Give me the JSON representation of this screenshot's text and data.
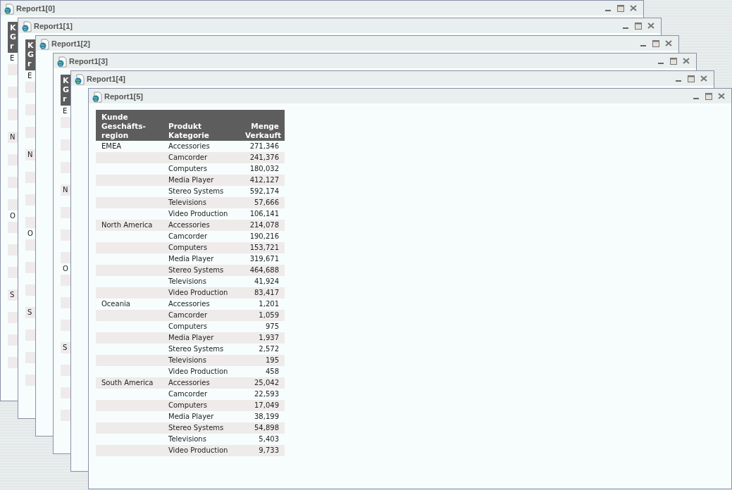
{
  "windows": [
    {
      "title": "Report1[0]",
      "fragment": {
        "header": [
          "K",
          "G",
          "r"
        ],
        "groups": [
          "E",
          "N",
          "O",
          "S"
        ]
      }
    },
    {
      "title": "Report1[1]",
      "fragment": {
        "header": [
          "K",
          "G",
          "r"
        ],
        "groups": [
          "E",
          "N",
          "O",
          "S"
        ]
      }
    },
    {
      "title": "Report1[2]"
    },
    {
      "title": "Report1[3]",
      "fragment": {
        "header": [
          "K",
          "G",
          "r"
        ],
        "groups": [
          "E",
          "N",
          "O",
          "S"
        ]
      }
    },
    {
      "title": "Report1[4]"
    },
    {
      "title": "Report1[5]",
      "report": {
        "columns": [
          "Kunde Geschäfts-region",
          "Produkt Kategorie",
          "Menge Verkauft"
        ],
        "groups": [
          {
            "region": "EMEA",
            "rows": [
              [
                "Accessories",
                "271,346"
              ],
              [
                "Camcorder",
                "241,376"
              ],
              [
                "Computers",
                "180,032"
              ],
              [
                "Media Player",
                "412,127"
              ],
              [
                "Stereo Systems",
                "592,174"
              ],
              [
                "Televisions",
                "57,666"
              ],
              [
                "Video Production",
                "106,141"
              ]
            ]
          },
          {
            "region": "North America",
            "rows": [
              [
                "Accessories",
                "214,078"
              ],
              [
                "Camcorder",
                "190,216"
              ],
              [
                "Computers",
                "153,721"
              ],
              [
                "Media Player",
                "319,671"
              ],
              [
                "Stereo Systems",
                "464,688"
              ],
              [
                "Televisions",
                "41,924"
              ],
              [
                "Video Production",
                "83,417"
              ]
            ]
          },
          {
            "region": "Oceania",
            "rows": [
              [
                "Accessories",
                "1,201"
              ],
              [
                "Camcorder",
                "1,059"
              ],
              [
                "Computers",
                "975"
              ],
              [
                "Media Player",
                "1,937"
              ],
              [
                "Stereo Systems",
                "2,572"
              ],
              [
                "Televisions",
                "195"
              ],
              [
                "Video Production",
                "458"
              ]
            ]
          },
          {
            "region": "South America",
            "rows": [
              [
                "Accessories",
                "25,042"
              ],
              [
                "Camcorder",
                "22,593"
              ],
              [
                "Computers",
                "17,049"
              ],
              [
                "Media Player",
                "38,199"
              ],
              [
                "Stereo Systems",
                "54,898"
              ],
              [
                "Televisions",
                "5,403"
              ],
              [
                "Video Production",
                "9,733"
              ]
            ]
          }
        ]
      }
    }
  ]
}
